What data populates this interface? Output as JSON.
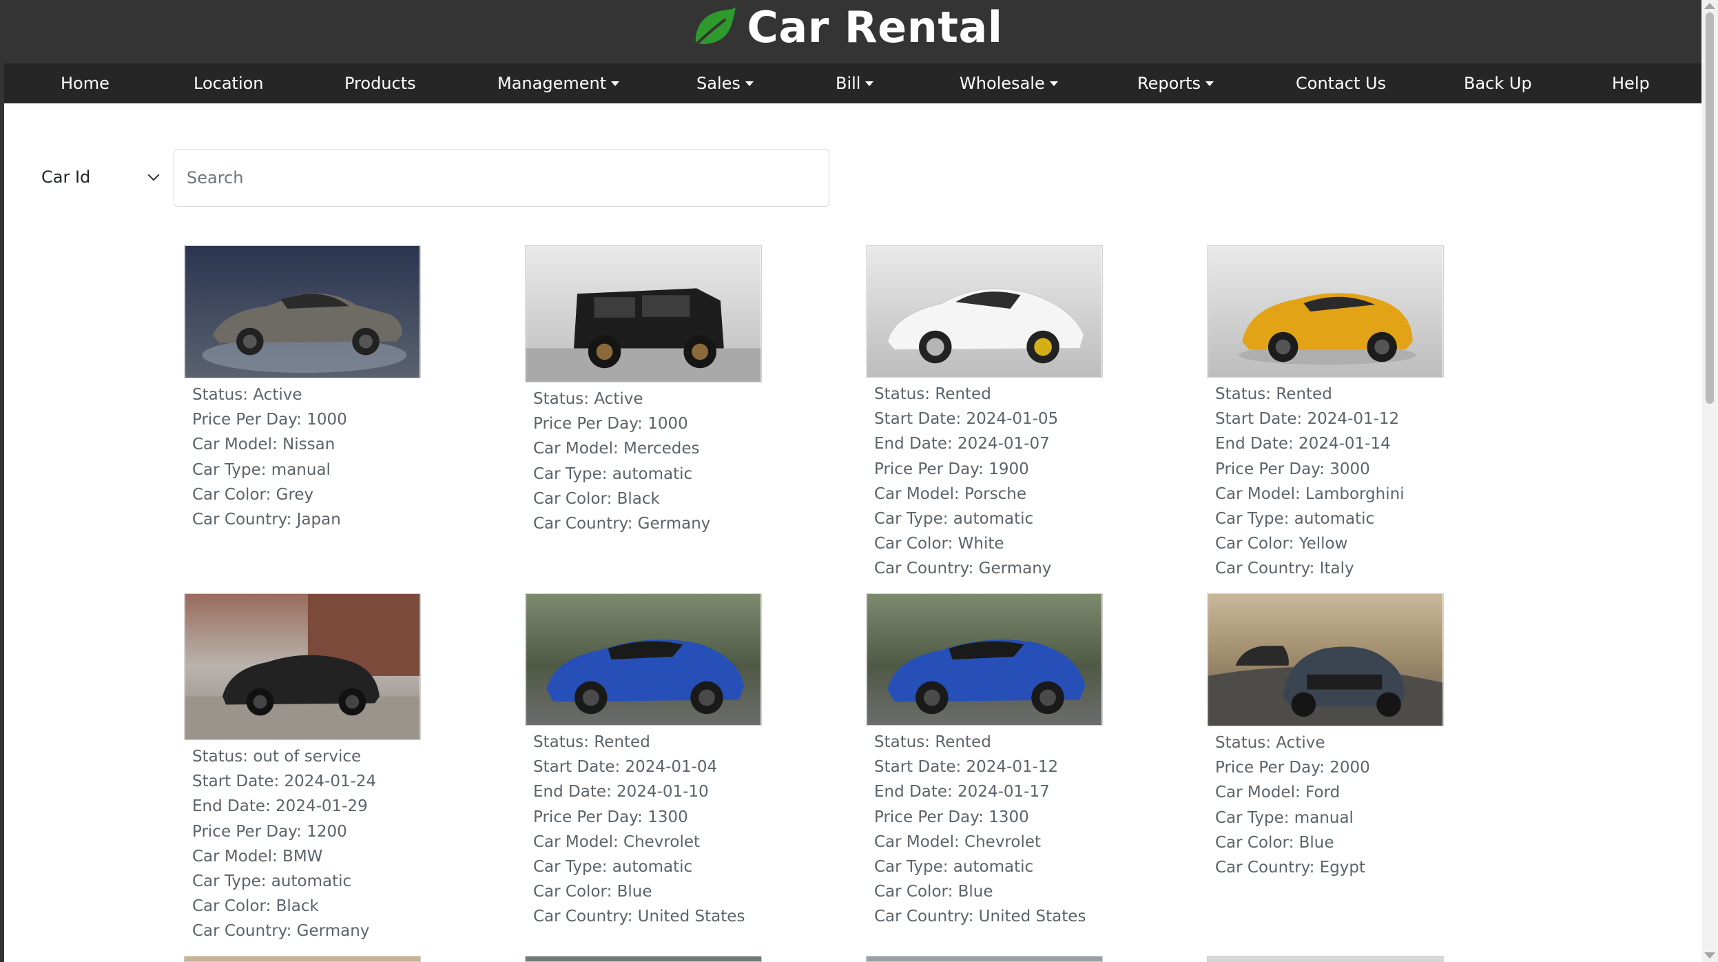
{
  "app": {
    "title": "Car Rental",
    "brand_color": "#2e9a2e",
    "header_bg": "#343434",
    "nav_bg": "#262626"
  },
  "nav": [
    {
      "label": "Home",
      "dropdown": false
    },
    {
      "label": "Location",
      "dropdown": false
    },
    {
      "label": "Products",
      "dropdown": false
    },
    {
      "label": "Management",
      "dropdown": true
    },
    {
      "label": "Sales",
      "dropdown": true
    },
    {
      "label": "Bill",
      "dropdown": true
    },
    {
      "label": "Wholesale",
      "dropdown": true
    },
    {
      "label": "Reports",
      "dropdown": true
    },
    {
      "label": "Contact Us",
      "dropdown": false
    },
    {
      "label": "Back Up",
      "dropdown": false
    },
    {
      "label": "Help",
      "dropdown": false
    }
  ],
  "filter": {
    "select_value": "Car Id",
    "search_placeholder": "Search",
    "search_value": ""
  },
  "cars": [
    {
      "image": "grey-nissan-sports-coupe",
      "lines": [
        "Status: Active",
        "Price Per Day: 1000",
        "Car Model: Nissan",
        "Car Type: manual",
        "Car Color: Grey",
        "Car Country: Japan"
      ]
    },
    {
      "image": "black-mercedes-suv",
      "lines": [
        "Status: Active",
        "Price Per Day: 1000",
        "Car Model: Mercedes",
        "Car Type: automatic",
        "Car Color: Black",
        "Car Country: Germany"
      ]
    },
    {
      "image": "white-porsche-sports-car",
      "lines": [
        "Status: Rented",
        "Start Date: 2024-01-05",
        "End Date: 2024-01-07",
        "Price Per Day: 1900",
        "Car Model: Porsche",
        "Car Type: automatic",
        "Car Color: White",
        "Car Country: Germany"
      ]
    },
    {
      "image": "yellow-lamborghini-suv",
      "lines": [
        "Status: Rented",
        "Start Date: 2024-01-12",
        "End Date: 2024-01-14",
        "Price Per Day: 3000",
        "Car Model: Lamborghini",
        "Car Type: automatic",
        "Car Color: Yellow",
        "Car Country: Italy"
      ]
    },
    {
      "image": "black-bmw-coupe",
      "lines": [
        "Status: out of service",
        "Start Date: 2024-01-24",
        "End Date: 2024-01-29",
        "Price Per Day: 1200",
        "Car Model: BMW",
        "Car Type: automatic",
        "Car Color: Black",
        "Car Country: Germany"
      ]
    },
    {
      "image": "blue-chevrolet-camaro",
      "lines": [
        "Status: Rented",
        "Start Date: 2024-01-04",
        "End Date: 2024-01-10",
        "Price Per Day: 1300",
        "Car Model: Chevrolet",
        "Car Type: automatic",
        "Car Color: Blue",
        "Car Country: United States"
      ]
    },
    {
      "image": "blue-chevrolet-camaro",
      "lines": [
        "Status: Rented",
        "Start Date: 2024-01-12",
        "End Date: 2024-01-17",
        "Price Per Day: 1300",
        "Car Model: Chevrolet",
        "Car Type: automatic",
        "Car Color: Blue",
        "Car Country: United States"
      ]
    },
    {
      "image": "blue-ford-mustang",
      "lines": [
        "Status: Active",
        "Price Per Day: 2000",
        "Car Model: Ford",
        "Car Type: manual",
        "Car Color: Blue",
        "Car Country: Egypt"
      ]
    }
  ]
}
